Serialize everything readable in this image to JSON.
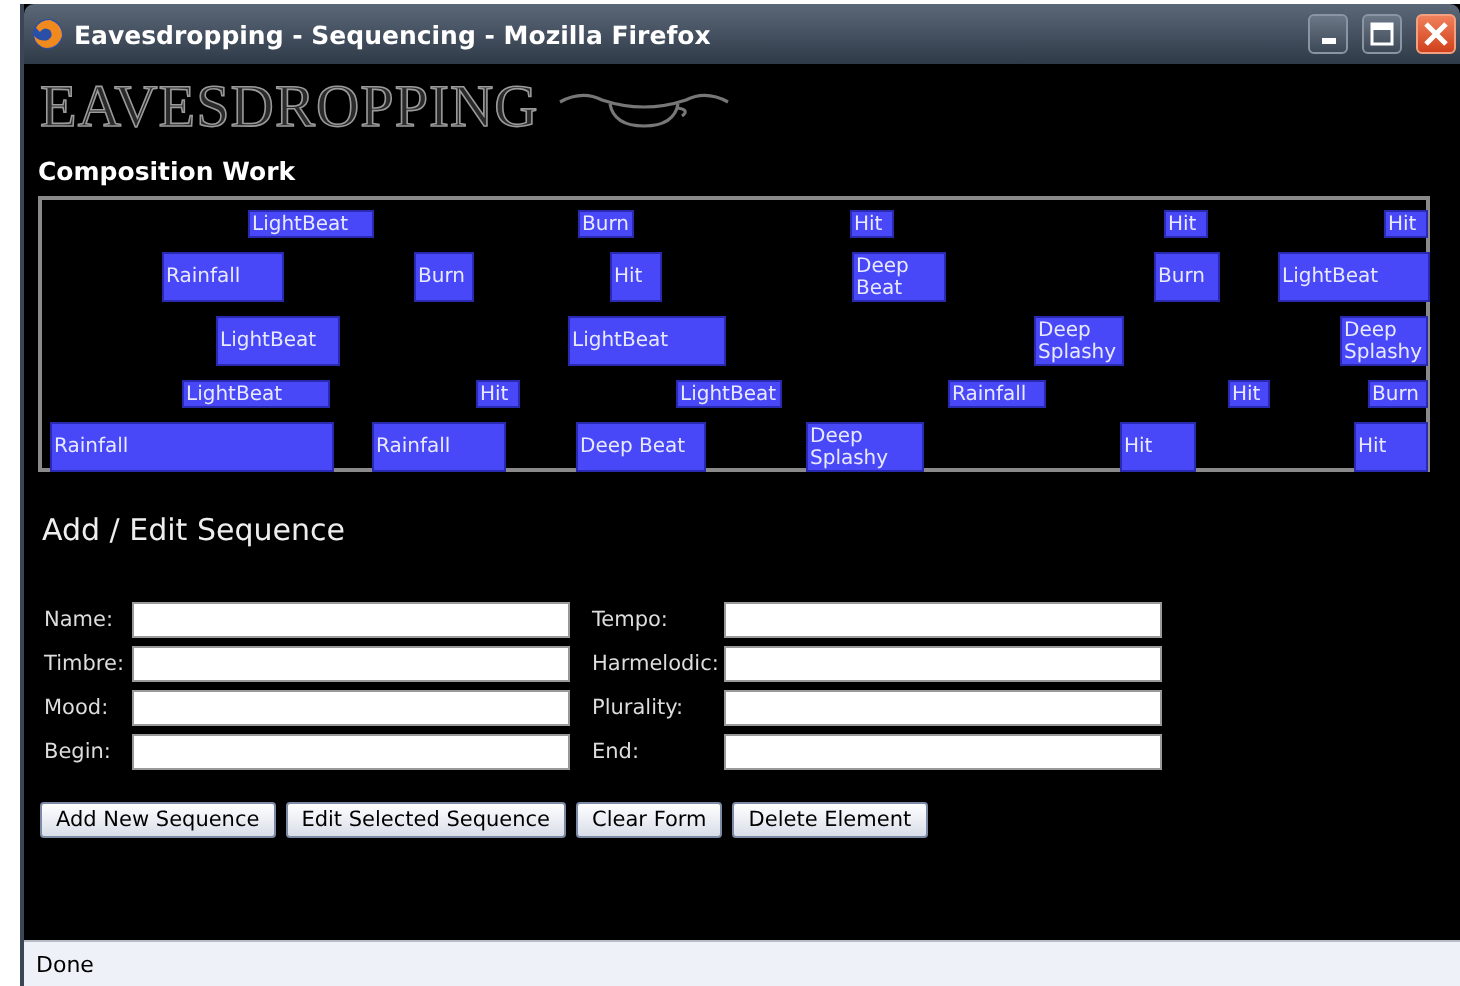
{
  "window": {
    "title": "Eavesdropping - Sequencing - Mozilla Firefox"
  },
  "logo": {
    "text": "EAVESDROPPING"
  },
  "composition": {
    "title": "Composition Work",
    "lanes": [
      [
        {
          "label": "LightBeat"
        },
        {
          "label": "Burn"
        },
        {
          "label": "Hit"
        },
        {
          "label": "Hit"
        },
        {
          "label": "Hit"
        }
      ],
      [
        {
          "label": "Rainfall"
        },
        {
          "label": "Burn"
        },
        {
          "label": "Hit"
        },
        {
          "label": "Deep Beat"
        },
        {
          "label": "Burn"
        },
        {
          "label": "LightBeat"
        }
      ],
      [
        {
          "label": "LightBeat"
        },
        {
          "label": "LightBeat"
        },
        {
          "label": "Deep Splashy"
        },
        {
          "label": "Deep Splashy"
        }
      ],
      [
        {
          "label": "LightBeat"
        },
        {
          "label": "Hit"
        },
        {
          "label": "LightBeat"
        },
        {
          "label": "Rainfall"
        },
        {
          "label": "Hit"
        },
        {
          "label": "Burn"
        }
      ],
      [
        {
          "label": "Rainfall"
        },
        {
          "label": "Rainfall"
        },
        {
          "label": "Deep Beat"
        },
        {
          "label": "Deep Splashy"
        },
        {
          "label": "Hit"
        },
        {
          "label": "Hit"
        }
      ]
    ]
  },
  "form": {
    "title": "Add / Edit Sequence",
    "fields": [
      {
        "label": "Name:"
      },
      {
        "label": "Tempo:"
      },
      {
        "label": "Timbre:"
      },
      {
        "label": "Harmelodic:"
      },
      {
        "label": "Mood:"
      },
      {
        "label": "Plurality:"
      },
      {
        "label": "Begin:"
      },
      {
        "label": "End:"
      }
    ],
    "buttons": [
      "Add New Sequence",
      "Edit Selected Sequence",
      "Clear Form",
      "Delete Element"
    ]
  },
  "status_bar": {
    "text": "Done"
  }
}
